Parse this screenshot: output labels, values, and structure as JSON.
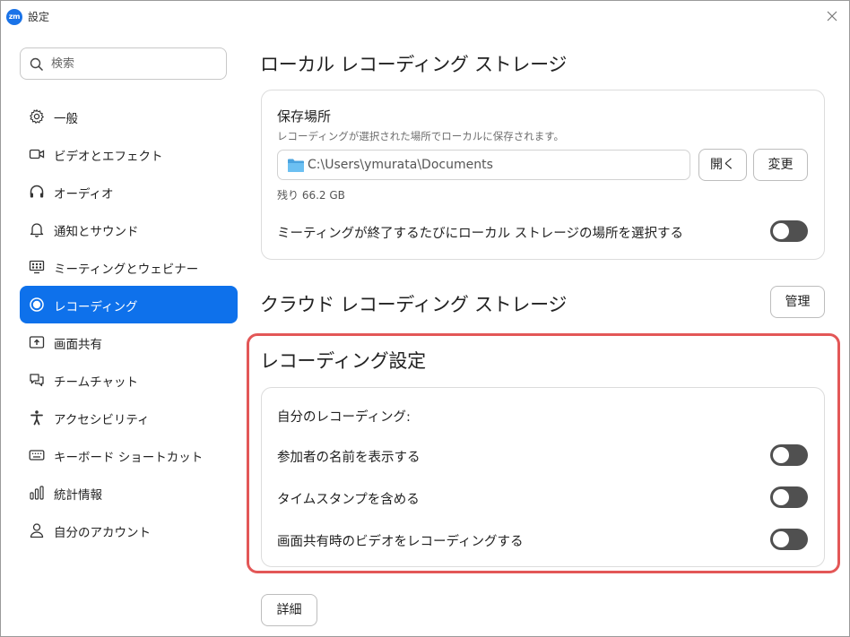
{
  "window": {
    "title": "設定",
    "app_logo": "zm"
  },
  "search": {
    "placeholder": "検索"
  },
  "sidebar": {
    "items": [
      {
        "label": "一般",
        "icon": "gear-icon"
      },
      {
        "label": "ビデオとエフェクト",
        "icon": "video-camera-icon"
      },
      {
        "label": "オーディオ",
        "icon": "headphones-icon"
      },
      {
        "label": "通知とサウンド",
        "icon": "bell-icon"
      },
      {
        "label": "ミーティングとウェビナー",
        "icon": "meeting-icon"
      },
      {
        "label": "レコーディング",
        "icon": "record-icon",
        "active": true
      },
      {
        "label": "画面共有",
        "icon": "share-screen-icon"
      },
      {
        "label": "チームチャット",
        "icon": "chat-icon"
      },
      {
        "label": "アクセシビリティ",
        "icon": "accessibility-icon"
      },
      {
        "label": "キーボード ショートカット",
        "icon": "keyboard-icon"
      },
      {
        "label": "統計情報",
        "icon": "bar-chart-icon"
      },
      {
        "label": "自分のアカウント",
        "icon": "user-icon"
      }
    ]
  },
  "local_storage": {
    "title": "ローカル レコーディング ストレージ",
    "location_label": "保存場所",
    "location_desc": "レコーディングが選択された場所でローカルに保存されます。",
    "path": "C:\\Users\\ymurata\\Documents",
    "open_label": "開く",
    "change_label": "変更",
    "remaining": "残り 66.2 GB",
    "choose_each_time_label": "ミーティングが終了するたびにローカル ストレージの場所を選択する",
    "choose_each_time_on": false
  },
  "cloud_storage": {
    "title": "クラウド レコーディング ストレージ",
    "manage_label": "管理"
  },
  "recording_settings": {
    "title": "レコーディング設定",
    "my_recording_label": "自分のレコーディング:",
    "options": [
      {
        "label": "参加者の名前を表示する",
        "on": false
      },
      {
        "label": "タイムスタンプを含める",
        "on": false
      },
      {
        "label": "画面共有時のビデオをレコーディングする",
        "on": false
      }
    ],
    "details_label": "詳細"
  },
  "colors": {
    "accent": "#0e71eb",
    "highlight": "#e35757",
    "toggle_off": "#505050"
  }
}
